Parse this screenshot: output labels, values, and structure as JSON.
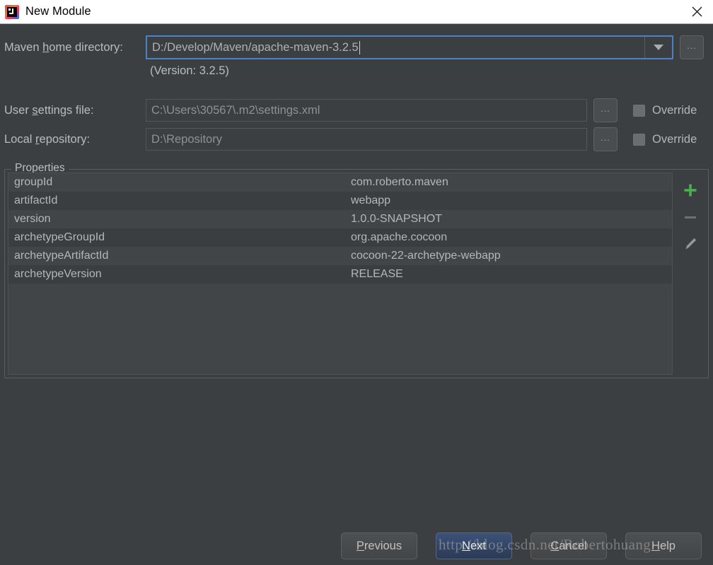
{
  "window": {
    "title": "New Module",
    "app_icon": "intellij-idea-icon",
    "close_icon": "close-icon"
  },
  "form": {
    "maven_home": {
      "label_before": "Maven ",
      "label_mnemonic": "h",
      "label_after": "ome directory:",
      "value": "D:/Develop/Maven/apache-maven-3.2.5",
      "dropdown_icon": "chevron-down-icon",
      "browse_label": "...",
      "version_note": "(Version: 3.2.5)"
    },
    "user_settings": {
      "label_before": "User ",
      "label_mnemonic": "s",
      "label_after": "ettings file:",
      "value": "C:\\Users\\30567\\.m2\\settings.xml",
      "browse_label": "...",
      "override_label": "Override",
      "override_checked": false
    },
    "local_repository": {
      "label_before": "Local ",
      "label_mnemonic": "r",
      "label_after": "epository:",
      "value": "D:\\Repository",
      "browse_label": "...",
      "override_label": "Override",
      "override_checked": false
    }
  },
  "properties": {
    "group_title": "Properties",
    "rows": [
      {
        "name": "groupId",
        "value": "com.roberto.maven"
      },
      {
        "name": "artifactId",
        "value": "webapp"
      },
      {
        "name": "version",
        "value": "1.0.0-SNAPSHOT"
      },
      {
        "name": "archetypeGroupId",
        "value": "org.apache.cocoon"
      },
      {
        "name": "archetypeArtifactId",
        "value": "cocoon-22-archetype-webapp"
      },
      {
        "name": "archetypeVersion",
        "value": "RELEASE"
      }
    ],
    "tools": {
      "add_icon": "plus-icon",
      "remove_icon": "minus-icon",
      "edit_icon": "pencil-icon"
    }
  },
  "buttons": {
    "previous": {
      "before": "",
      "mnemonic": "P",
      "after": "revious"
    },
    "next": {
      "before": "",
      "mnemonic": "N",
      "after": "ext"
    },
    "cancel": {
      "before": "",
      "mnemonic": "C",
      "after": "ancel"
    },
    "help": {
      "before": "",
      "mnemonic": "H",
      "after": "elp"
    }
  },
  "watermark": {
    "text": "http://blog.csdn.net/Robertohuang"
  },
  "colors": {
    "dialog_bg": "#3c3f41",
    "focus_border": "#4b83c8",
    "primary_button": "#3c5278",
    "add_icon_green": "#4caf50",
    "row_odd": "#414548",
    "row_even": "#3a3e41"
  }
}
